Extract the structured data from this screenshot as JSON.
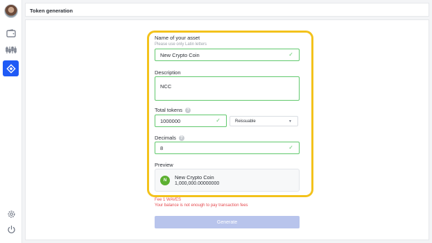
{
  "header": {
    "title": "Token generation"
  },
  "sidebar": {
    "items": [
      {
        "icon": "wallet-icon"
      },
      {
        "icon": "exchange-icon"
      },
      {
        "icon": "token-icon",
        "active": true
      },
      {
        "icon": "settings-icon"
      },
      {
        "icon": "logout-icon"
      }
    ]
  },
  "form": {
    "name": {
      "label": "Name of your asset",
      "hint": "Please use only Latin letters",
      "value": "New Crypto Coin"
    },
    "description": {
      "label": "Description",
      "value": "NCC"
    },
    "total": {
      "label": "Total tokens",
      "value": "1000000",
      "reissue_option": "Reissuable"
    },
    "decimals": {
      "label": "Decimals",
      "value": "8"
    },
    "preview": {
      "label": "Preview",
      "badge": "N",
      "name": "New Crypto Coin",
      "amount": "1,000,000.00000000"
    },
    "fee": {
      "text": "Fee 1 WAVES",
      "warning": "Your balance is not enough to pay transaction fees"
    },
    "generate_label": "Generate"
  },
  "colors": {
    "accent": "#1f5af6",
    "valid": "#5fc86b",
    "highlight": "#f3c21b",
    "error": "#e5484d",
    "button_disabled": "#b8c4ec"
  }
}
